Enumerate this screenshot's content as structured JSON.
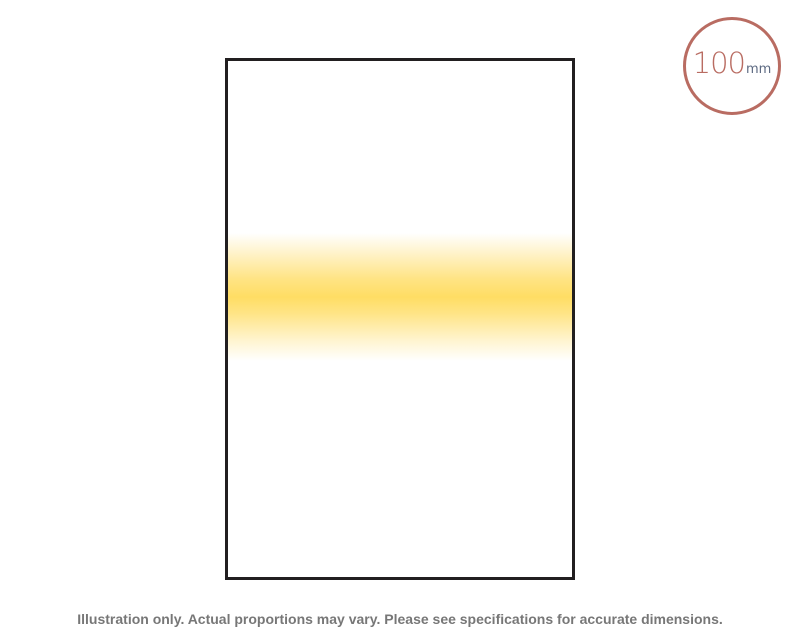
{
  "product": {
    "filter_color": "#ffdd64",
    "frame_color": "#221f20"
  },
  "size_badge": {
    "number": "100",
    "unit": "mm",
    "ring_color": "#b96c62",
    "unit_color": "#5d6a82"
  },
  "disclaimer": {
    "text": "Illustration only. Actual proportions may vary. Please see specifications for accurate dimensions."
  }
}
